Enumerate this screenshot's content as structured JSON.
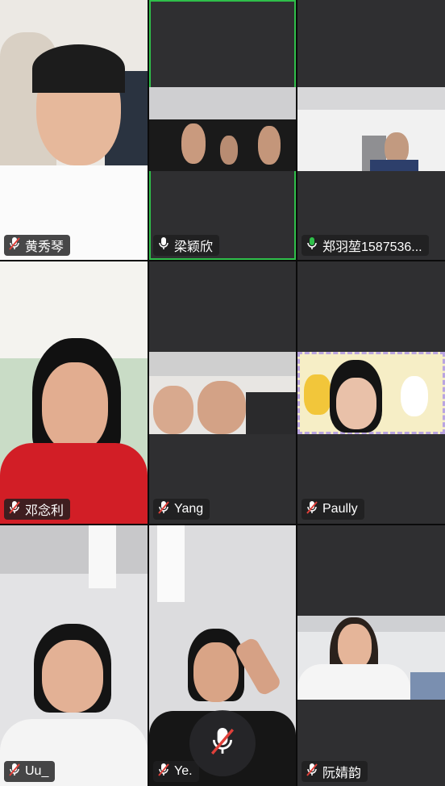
{
  "participants": [
    {
      "name": "黄秀琴",
      "mic": "muted",
      "icon": "mic-muted-icon",
      "video": "on"
    },
    {
      "name": "梁颖欣",
      "mic": "unmuted",
      "icon": "mic-icon",
      "video": "on",
      "active_speaker": true
    },
    {
      "name": "郑羽堃1587536...",
      "mic": "speaking",
      "icon": "mic-speaking-icon",
      "video": "on"
    },
    {
      "name": "邓念利",
      "mic": "muted",
      "icon": "mic-muted-icon",
      "video": "on"
    },
    {
      "name": "Yang",
      "mic": "muted",
      "icon": "mic-muted-icon",
      "video": "on"
    },
    {
      "name": "Paully",
      "mic": "muted",
      "icon": "mic-muted-icon",
      "video": "on"
    },
    {
      "name": "Uu_",
      "mic": "muted",
      "icon": "mic-muted-icon",
      "video": "on"
    },
    {
      "name": "Ye.",
      "mic": "muted",
      "icon": "mic-muted-icon",
      "video": "on"
    },
    {
      "name": "阮婧韵",
      "mic": "muted",
      "icon": "mic-muted-icon",
      "video": "on"
    }
  ],
  "controls": {
    "self_mic_state": "muted",
    "self_mic_icon": "mic-muted-icon"
  },
  "colors": {
    "active_border": "#2fbf4a",
    "tile_bg": "#2f2f31",
    "muted_slash": "#e0403a",
    "speaking_mic": "#2fbf4a"
  }
}
